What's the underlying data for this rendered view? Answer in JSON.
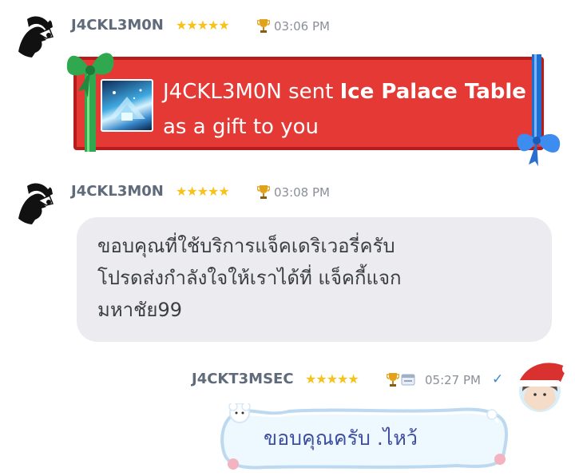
{
  "messages": [
    {
      "username": "J4CKL3M0N",
      "stars": "★★★★★",
      "time": "03:06 PM",
      "gift": {
        "sender": "J4CKL3M0N",
        "verb": "sent",
        "item": "Ice Palace Table",
        "suffix": "as a gift to you"
      }
    },
    {
      "username": "J4CKL3M0N",
      "stars": "★★★★★",
      "time": "03:08 PM",
      "text": "ขอบคุณที่ใช้บริการแจ็คเดริเวอรี่ครับ\nโปรดส่งกำลังใจให้เราได้ที่ แจ็คกี้แจก\nมหาชัย99"
    },
    {
      "username": "J4CKT3MSEC",
      "stars": "★★★★★",
      "time": "05:27 PM",
      "text": "ขอบคุณครับ .ไหว้",
      "read_icon": "checkmark-icon"
    }
  ],
  "colors": {
    "gift_bg": "#e53935",
    "username": "#5f6a7a",
    "bubble_in": "#ececf0",
    "bubble_out_text": "#3e4ea0",
    "star": "#f7c21a",
    "read_check": "#3a88d8"
  }
}
